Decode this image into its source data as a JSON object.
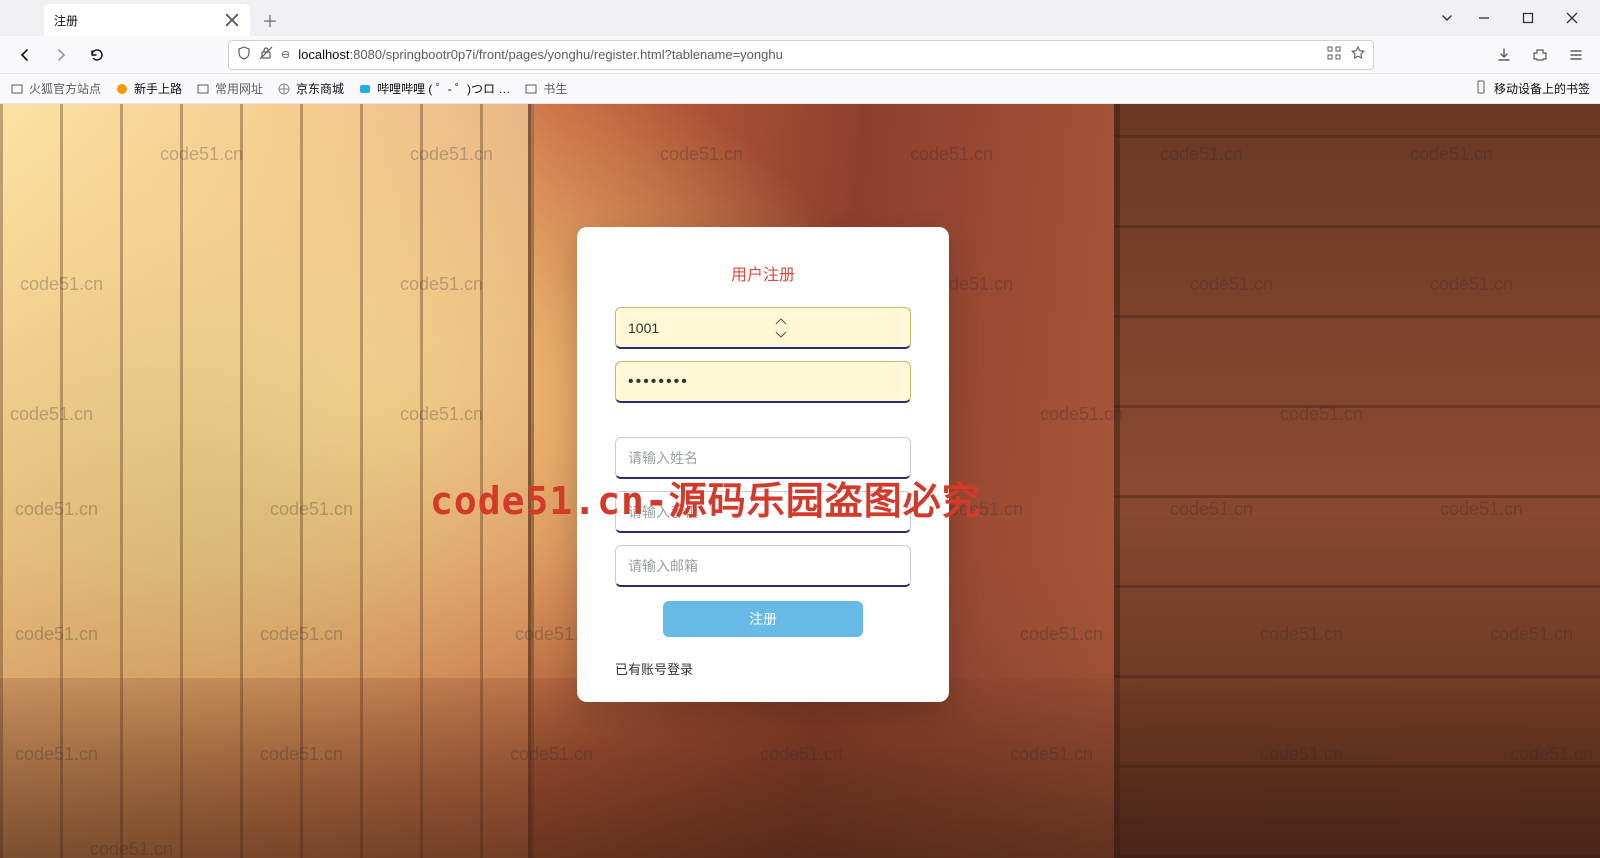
{
  "browser": {
    "tab_title": "注册",
    "url_host": "localhost",
    "url_port_path": ":8080/springbootr0p7i/front/pages/yonghu/register.html?tablename=yonghu",
    "bookmarks": [
      "火狐官方站点",
      "新手上路",
      "常用网址",
      "京东商城",
      "哔哩哔哩 ( ゜- ゜)つロ …",
      "书生"
    ],
    "mobile_bookmarks_label": "移动设备上的书签"
  },
  "card": {
    "title": "用户注册",
    "username_value": "1001",
    "password_masked": "••••••••",
    "name_placeholder": "请输入姓名",
    "phone_placeholder": "请输入手机",
    "email_placeholder": "请输入邮箱",
    "submit_label": "注册",
    "login_link_label": "已有账号登录"
  },
  "watermark": {
    "small": "code51.cn",
    "big": "code51.cn-源码乐园盗图必究"
  }
}
